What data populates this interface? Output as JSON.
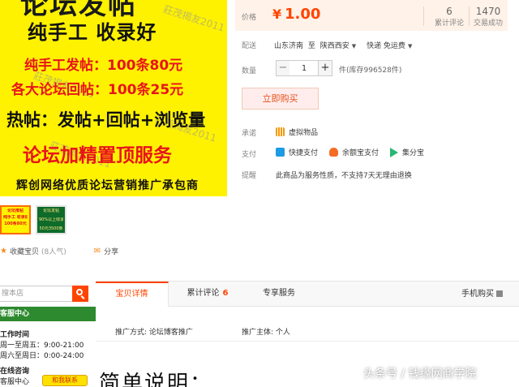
{
  "banner": {
    "title": "论坛发帖",
    "line2": "纯手工  收录好",
    "offer1": "纯手工发帖：100条80元",
    "offer2": "各大论坛回帖：100条25元",
    "hot": "热帖：发帖+回帖+浏览量",
    "service": "论坛加精置顶服务",
    "footer": "辉创网络优质论坛营销推广承包商",
    "watermark": "莊茂揭友2011"
  },
  "thumbs": {
    "t1_lines": [
      "论坛推帖",
      "纯手工 收录好",
      "100条80元"
    ],
    "t2_lines": [
      "论坛发帖",
      "90%以上收录率",
      "50元3500条"
    ]
  },
  "actions": {
    "favorite": "收藏宝贝",
    "favorite_count": "(8人气)",
    "share": "分享"
  },
  "product": {
    "price_label": "价格",
    "currency": "¥",
    "price": "1.00",
    "reviews_count": "6",
    "reviews_label": "累计评论",
    "deals_count": "1470",
    "deals_label": "交易成功",
    "delivery_label": "配送",
    "delivery_from": "山东济南",
    "delivery_to_word": "至",
    "delivery_to": "陕西西安",
    "shipping": "快递 免运费",
    "qty_label": "数量",
    "qty_value": "1",
    "stock_text": "件(库存996528件)",
    "buy_button": "立即购买",
    "promise_label": "承诺",
    "promise_value": "虚拟物品",
    "pay_label": "支付",
    "pay_methods": [
      "快捷支付",
      "余额宝支付",
      "集分宝"
    ],
    "notice_label": "提醒",
    "notice_value": "此商品为服务性质，不支持7天无理由退换"
  },
  "sidebar": {
    "search_placeholder": "搜本店",
    "cs_title": "客服中心",
    "hours_title": "工作时间",
    "hours_weekday": "周一至周五：9:00-21:00",
    "hours_weekend": "周六至周日：0:00-24:00",
    "consult_title": "在线咨询",
    "consult_label": "客服中心",
    "ww_button": "和我联系"
  },
  "tabs": {
    "items": [
      {
        "label": "宝贝详情",
        "count": ""
      },
      {
        "label": "累计评论",
        "count": "6"
      },
      {
        "label": "专享服务",
        "count": ""
      }
    ],
    "mobile_buy": "手机购买"
  },
  "details": {
    "attr1": "推广方式: 论坛博客推广",
    "attr2": "推广主体: 个人",
    "desc_title": "简单说明："
  },
  "overlay": {
    "source_watermark": "头条号 / 钱缘网商学院"
  },
  "colors": {
    "accent": "#ff4400",
    "banner_bg": "#fff200",
    "banner_red": "#e8141a",
    "cs_green": "#2d8a2e"
  }
}
